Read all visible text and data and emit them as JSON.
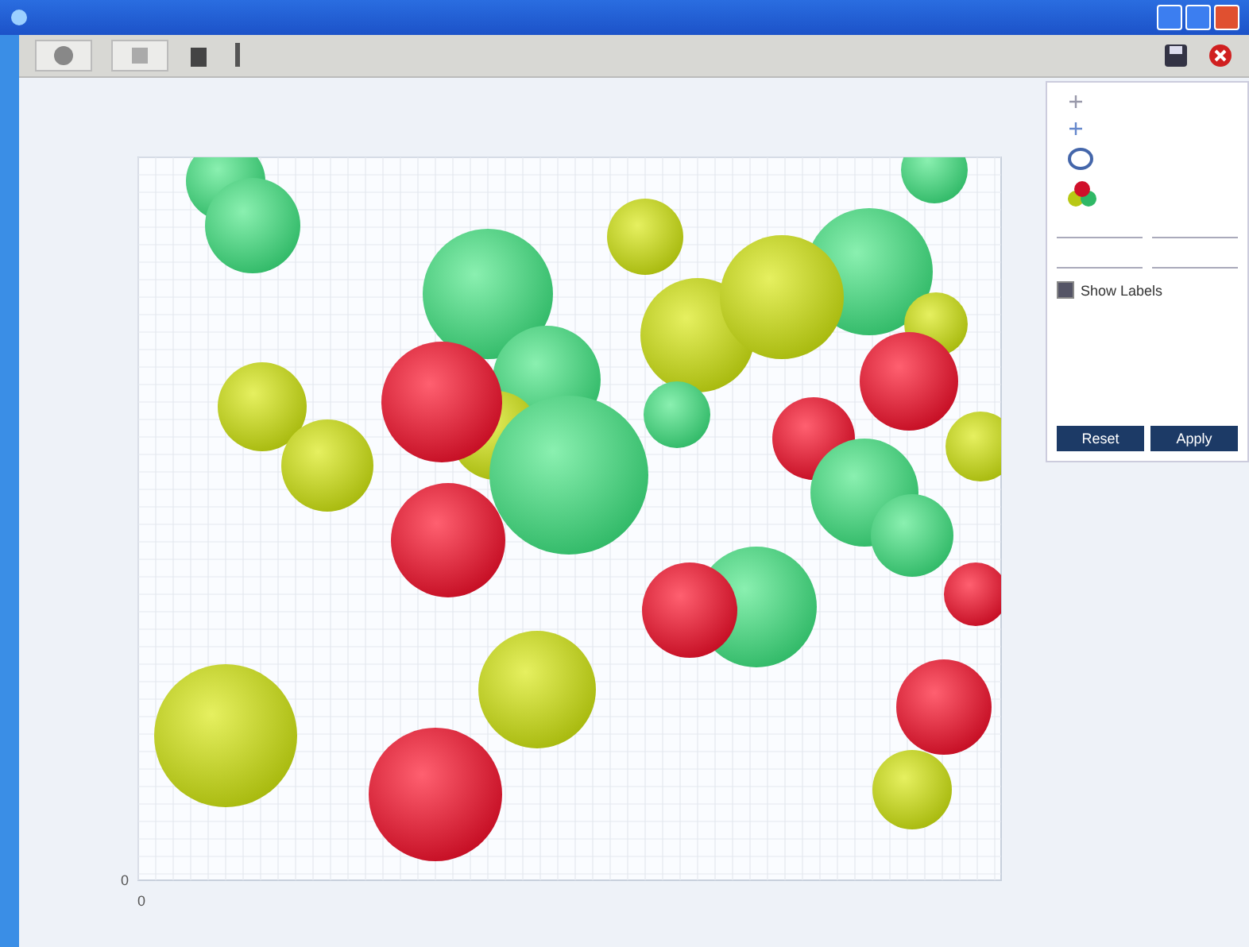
{
  "chart": {
    "y_axis_ticks": [
      "0"
    ],
    "x_axis_ticks": [
      "0"
    ]
  },
  "settings_panel": {
    "show_labels": {
      "label": "Show Labels",
      "checked": true
    },
    "buttons": [
      {
        "label": "Reset"
      },
      {
        "label": "Apply"
      }
    ]
  }
}
